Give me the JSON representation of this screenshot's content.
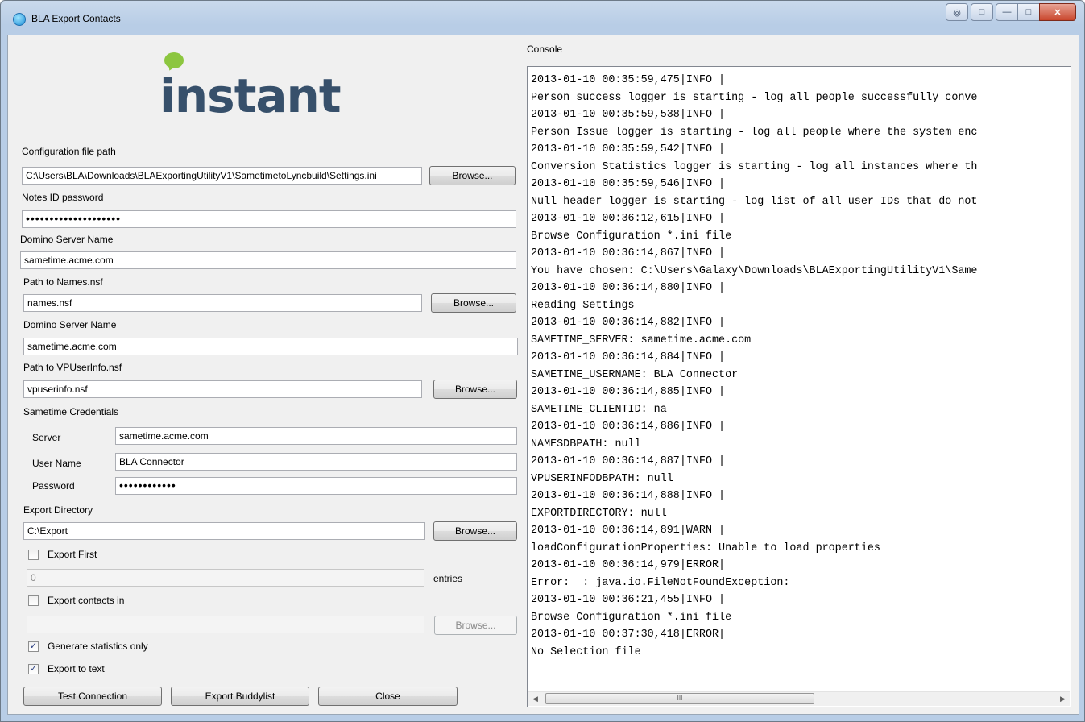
{
  "window": {
    "title": "BLA Export Contacts"
  },
  "form": {
    "config_path_label": "Configuration file path",
    "config_path_value": "C:\\Users\\BLA\\Downloads\\BLAExportingUtilityV1\\SametimetoLyncbuild\\Settings.ini",
    "notes_id_password_label": "Notes ID password",
    "notes_id_password_value": "••••••••••••••••••••",
    "domino_server_label_1": "Domino Server Name",
    "domino_server_value_1": "sametime.acme.com",
    "names_path_label": "Path to Names.nsf",
    "names_path_value": "names.nsf",
    "domino_server_label_2": "Domino Server Name",
    "domino_server_value_2": "sametime.acme.com",
    "vpuserinfo_label": "Path to VPUserInfo.nsf",
    "vpuserinfo_value": "vpuserinfo.nsf",
    "sametime_credentials_label": "Sametime Credentials",
    "server_label": "Server",
    "server_value": "sametime.acme.com",
    "username_label": "User Name",
    "username_value": "BLA Connector",
    "password_label": "Password",
    "password_value": "••••••••••••",
    "export_dir_label": "Export Directory",
    "export_dir_value": "C:\\Export",
    "export_first_label": "Export First",
    "export_first_checked": false,
    "entries_value": "0",
    "entries_label": "entries",
    "export_contacts_in_label": "Export contacts in",
    "export_contacts_in_checked": false,
    "export_contacts_in_value": "",
    "generate_stats_label": "Generate statistics only",
    "generate_stats_checked": true,
    "export_text_label": "Export to text",
    "export_text_checked": true,
    "browse_label": "Browse...",
    "check_mark": "✓"
  },
  "buttons": {
    "test_connection": "Test Connection",
    "export_buddylist": "Export Buddylist",
    "close": "Close"
  },
  "logo": {
    "text": "instant"
  },
  "console": {
    "label": "Console",
    "scroll_thumb": "III",
    "lines": [
      "2013-01-10 00:35:59,475|INFO |",
      "Person success logger is starting - log all people successfully conve",
      "2013-01-10 00:35:59,538|INFO |",
      "Person Issue logger is starting - log all people where the system enc",
      "2013-01-10 00:35:59,542|INFO |",
      "Conversion Statistics logger is starting - log all instances where th",
      "2013-01-10 00:35:59,546|INFO |",
      "Null header logger is starting - log list of all user IDs that do not",
      "2013-01-10 00:36:12,615|INFO |",
      "Browse Configuration *.ini file",
      "2013-01-10 00:36:14,867|INFO |",
      "You have chosen: C:\\Users\\Galaxy\\Downloads\\BLAExportingUtilityV1\\Same",
      "2013-01-10 00:36:14,880|INFO |",
      "Reading Settings",
      "2013-01-10 00:36:14,882|INFO |",
      "SAMETIME_SERVER: sametime.acme.com",
      "2013-01-10 00:36:14,884|INFO |",
      "SAMETIME_USERNAME: BLA Connector",
      "2013-01-10 00:36:14,885|INFO |",
      "SAMETIME_CLIENTID: na",
      "2013-01-10 00:36:14,886|INFO |",
      "NAMESDBPATH: null",
      "2013-01-10 00:36:14,887|INFO |",
      "VPUSERINFODBPATH: null",
      "2013-01-10 00:36:14,888|INFO |",
      "EXPORTDIRECTORY: null",
      "2013-01-10 00:36:14,891|WARN |",
      "loadConfigurationProperties: Unable to load properties",
      "2013-01-10 00:36:14,979|ERROR|",
      "Error:  : java.io.FileNotFoundException:",
      "2013-01-10 00:36:21,455|INFO |",
      "Browse Configuration *.ini file",
      "2013-01-10 00:37:30,418|ERROR|",
      "No Selection file"
    ]
  }
}
